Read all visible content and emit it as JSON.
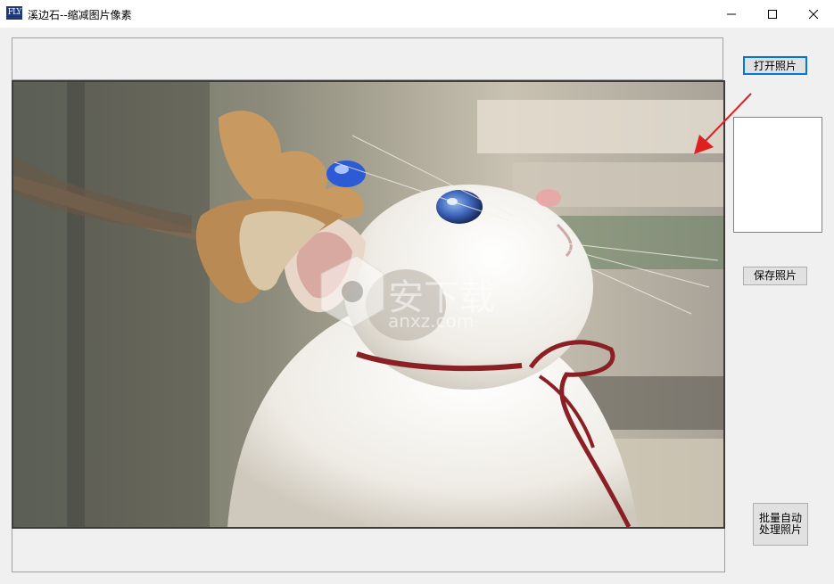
{
  "window": {
    "app_icon_text": "FLY",
    "title": "溪边石--缩减图片像素",
    "controls": {
      "minimize": "minimize-icon",
      "maximize": "maximize-icon",
      "close": "close-icon"
    }
  },
  "buttons": {
    "open": "打开照片",
    "save": "保存照片",
    "batch_line1": "批量自动",
    "batch_line2": "处理照片"
  },
  "photo": {
    "subject": "white cat wearing antler headband and red ribbon",
    "watermark_cn": "安下载",
    "watermark_en": "anxz.com"
  },
  "annotation": {
    "arrow_color": "#e02020"
  },
  "colors": {
    "window_bg": "#f0f0f0",
    "titlebar_bg": "#ffffff",
    "focus_border": "#0078d7"
  }
}
